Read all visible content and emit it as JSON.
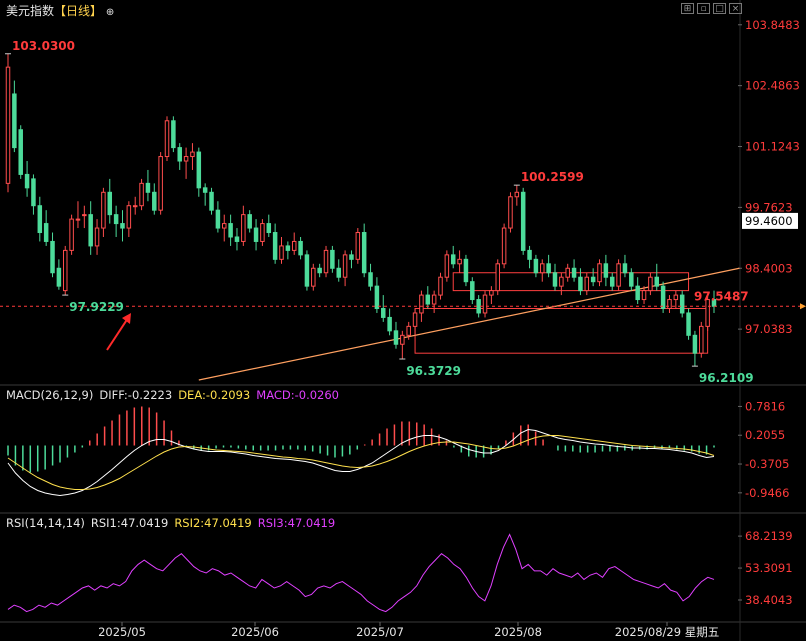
{
  "title": "美元指数",
  "period_tag": "【日线】",
  "header_icon": "plus-circle-icon",
  "window_buttons": [
    "grid-icon",
    "restore-icon",
    "max-icon",
    "close-icon"
  ],
  "colors": {
    "background": "#000000",
    "up": "#ff4d4d",
    "down": "#4ddb9a",
    "price_label": "#ff3b3b",
    "axis_text": "#ff3b3b",
    "trendline": "#ffa060",
    "box": "#ff4040",
    "current_price_box": "#ffffff",
    "macd_diff": "#ffffff",
    "macd_dea": "#ffe04d",
    "rsi1": "#e040ff",
    "rsi2": "#ffe04d",
    "rsi3": "#e040ff",
    "date_axis_text": "#e6e6e6"
  },
  "main": {
    "y_ticks": [
      "103.8483",
      "102.4863",
      "101.1243",
      "99.7623",
      "98.4003",
      "97.0383"
    ],
    "current_price": "99.4600",
    "last_close_label": "97.5487",
    "annotations": {
      "high": {
        "text": "103.0300",
        "color": "#ff3b3b"
      },
      "low1": {
        "text": "97.9229",
        "color": "#4ddb9a"
      },
      "peak2": {
        "text": "100.2599",
        "color": "#ff3b3b"
      },
      "low2": {
        "text": "96.3729",
        "color": "#4ddb9a"
      },
      "low3": {
        "text": "96.2109",
        "color": "#4ddb9a"
      }
    }
  },
  "macd": {
    "label": "MACD(26,12,9)",
    "diff": "DIFF:-0.2223",
    "dea": "DEA:-0.2093",
    "macd": "MACD:-0.0260",
    "y_ticks": [
      "0.7816",
      "0.2055",
      "-0.3705",
      "-0.9466"
    ]
  },
  "rsi": {
    "label": "RSI(14,14,14)",
    "rsi1": "RSI1:47.0419",
    "rsi2": "RSI2:47.0419",
    "rsi3": "RSI3:47.0419",
    "y_ticks": [
      "68.2139",
      "53.3091",
      "38.4043"
    ]
  },
  "x_axis": {
    "labels": [
      "2025/05",
      "2025/06",
      "2025/07",
      "2025/08",
      "2025/08/29 星期五"
    ]
  },
  "chart_data": [
    {
      "type": "candlestick",
      "y_range": [
        95.9,
        104.0
      ],
      "ohlc": [
        [
          100.3,
          103.2,
          100.1,
          102.9
        ],
        [
          102.3,
          102.6,
          101.0,
          101.1
        ],
        [
          101.5,
          101.6,
          100.4,
          100.5
        ],
        [
          100.5,
          100.8,
          100.0,
          100.2
        ],
        [
          100.4,
          100.5,
          99.6,
          99.8
        ],
        [
          99.8,
          100.0,
          99.0,
          99.2
        ],
        [
          99.4,
          99.7,
          98.9,
          99.0
        ],
        [
          99.0,
          99.2,
          98.2,
          98.3
        ],
        [
          98.4,
          98.6,
          97.92,
          98.0
        ],
        [
          97.9,
          98.9,
          97.8,
          98.8
        ],
        [
          98.8,
          99.6,
          98.7,
          99.5
        ],
        [
          99.5,
          99.9,
          99.3,
          99.5
        ],
        [
          99.6,
          99.8,
          99.3,
          99.6
        ],
        [
          99.6,
          99.9,
          98.7,
          98.9
        ],
        [
          98.9,
          99.5,
          98.7,
          99.3
        ],
        [
          99.3,
          100.2,
          99.1,
          100.1
        ],
        [
          100.1,
          100.4,
          99.4,
          99.6
        ],
        [
          99.6,
          99.8,
          99.1,
          99.4
        ],
        [
          99.4,
          99.7,
          99.0,
          99.3
        ],
        [
          99.3,
          99.9,
          99.1,
          99.8
        ],
        [
          99.8,
          100.0,
          99.6,
          99.8
        ],
        [
          99.8,
          100.4,
          99.7,
          100.3
        ],
        [
          100.3,
          100.6,
          99.9,
          100.1
        ],
        [
          100.1,
          100.3,
          99.6,
          99.7
        ],
        [
          99.7,
          101.0,
          99.6,
          100.9
        ],
        [
          100.9,
          101.8,
          100.8,
          101.7
        ],
        [
          101.7,
          101.8,
          101.0,
          101.1
        ],
        [
          101.1,
          101.2,
          100.6,
          100.8
        ],
        [
          100.8,
          101.1,
          100.4,
          100.9
        ],
        [
          100.9,
          101.2,
          100.6,
          101.0
        ],
        [
          101.0,
          101.1,
          100.0,
          100.2
        ],
        [
          100.2,
          100.3,
          99.8,
          100.1
        ],
        [
          100.1,
          100.2,
          99.6,
          99.7
        ],
        [
          99.7,
          99.9,
          99.2,
          99.3
        ],
        [
          99.3,
          99.6,
          99.0,
          99.4
        ],
        [
          99.4,
          99.6,
          98.9,
          99.1
        ],
        [
          99.1,
          99.3,
          98.8,
          99.0
        ],
        [
          99.0,
          99.8,
          98.9,
          99.6
        ],
        [
          99.6,
          99.7,
          99.2,
          99.3
        ],
        [
          99.3,
          99.5,
          98.8,
          99.0
        ],
        [
          99.0,
          99.5,
          98.9,
          99.4
        ],
        [
          99.4,
          99.6,
          99.1,
          99.2
        ],
        [
          99.2,
          99.4,
          98.5,
          98.6
        ],
        [
          98.6,
          99.1,
          98.5,
          98.9
        ],
        [
          98.9,
          99.0,
          98.6,
          98.8
        ],
        [
          98.8,
          99.2,
          98.7,
          99.0
        ],
        [
          99.0,
          99.1,
          98.6,
          98.7
        ],
        [
          98.7,
          98.8,
          97.9,
          98.0
        ],
        [
          98.0,
          98.5,
          97.9,
          98.4
        ],
        [
          98.4,
          98.5,
          98.2,
          98.3
        ],
        [
          98.3,
          98.9,
          98.2,
          98.8
        ],
        [
          98.8,
          98.9,
          98.3,
          98.4
        ],
        [
          98.4,
          98.6,
          98.1,
          98.2
        ],
        [
          98.2,
          98.8,
          98.0,
          98.7
        ],
        [
          98.7,
          98.8,
          98.4,
          98.6
        ],
        [
          98.6,
          99.3,
          98.5,
          99.2
        ],
        [
          99.2,
          99.4,
          98.2,
          98.3
        ],
        [
          98.3,
          98.5,
          97.9,
          98.0
        ],
        [
          98.0,
          98.2,
          97.4,
          97.5
        ],
        [
          97.5,
          97.8,
          97.2,
          97.3
        ],
        [
          97.3,
          97.5,
          96.9,
          97.0
        ],
        [
          97.0,
          97.2,
          96.6,
          96.7
        ],
        [
          96.7,
          97.0,
          96.37,
          96.9
        ],
        [
          96.9,
          97.2,
          96.8,
          97.1
        ],
        [
          97.1,
          97.5,
          96.9,
          97.4
        ],
        [
          97.4,
          97.9,
          97.2,
          97.8
        ],
        [
          97.8,
          98.0,
          97.5,
          97.6
        ],
        [
          97.6,
          97.9,
          97.4,
          97.8
        ],
        [
          97.8,
          98.3,
          97.7,
          98.2
        ],
        [
          98.2,
          98.8,
          98.1,
          98.7
        ],
        [
          98.7,
          98.9,
          98.4,
          98.5
        ],
        [
          98.5,
          98.8,
          98.3,
          98.6
        ],
        [
          98.6,
          98.7,
          98.0,
          98.1
        ],
        [
          98.1,
          98.2,
          97.6,
          97.7
        ],
        [
          97.7,
          97.8,
          97.3,
          97.4
        ],
        [
          97.4,
          97.9,
          97.3,
          97.8
        ],
        [
          97.8,
          98.0,
          97.6,
          97.9
        ],
        [
          97.9,
          98.6,
          97.8,
          98.5
        ],
        [
          98.5,
          99.4,
          98.4,
          99.3
        ],
        [
          99.3,
          100.1,
          99.2,
          100.0
        ],
        [
          100.0,
          100.26,
          99.8,
          100.1
        ],
        [
          100.1,
          100.2,
          98.7,
          98.8
        ],
        [
          98.8,
          98.9,
          98.4,
          98.6
        ],
        [
          98.6,
          98.7,
          98.2,
          98.3
        ],
        [
          98.3,
          98.6,
          98.1,
          98.5
        ],
        [
          98.5,
          98.7,
          98.2,
          98.3
        ],
        [
          98.3,
          98.5,
          97.9,
          98.0
        ],
        [
          98.0,
          98.3,
          97.8,
          98.2
        ],
        [
          98.2,
          98.5,
          98.1,
          98.4
        ],
        [
          98.4,
          98.6,
          98.1,
          98.2
        ],
        [
          98.2,
          98.4,
          97.8,
          97.9
        ],
        [
          97.9,
          98.3,
          97.8,
          98.2
        ],
        [
          98.2,
          98.4,
          98.0,
          98.1
        ],
        [
          98.1,
          98.6,
          98.0,
          98.5
        ],
        [
          98.5,
          98.7,
          98.0,
          98.2
        ],
        [
          98.2,
          98.3,
          97.9,
          98.0
        ],
        [
          98.0,
          98.6,
          97.9,
          98.5
        ],
        [
          98.5,
          98.7,
          98.2,
          98.3
        ],
        [
          98.3,
          98.4,
          97.9,
          98.0
        ],
        [
          98.0,
          98.2,
          97.6,
          97.7
        ],
        [
          97.7,
          98.0,
          97.6,
          97.9
        ],
        [
          97.9,
          98.3,
          97.8,
          98.2
        ],
        [
          98.2,
          98.5,
          97.9,
          98.0
        ],
        [
          98.0,
          98.1,
          97.4,
          97.5
        ],
        [
          97.5,
          97.8,
          97.4,
          97.7
        ],
        [
          97.7,
          97.9,
          97.5,
          97.8
        ],
        [
          97.8,
          97.9,
          97.3,
          97.4
        ],
        [
          97.4,
          97.5,
          96.8,
          96.9
        ],
        [
          96.9,
          97.0,
          96.21,
          96.5
        ],
        [
          96.5,
          97.2,
          96.4,
          97.1
        ],
        [
          97.1,
          97.8,
          97.0,
          97.7
        ],
        [
          97.7,
          97.9,
          97.4,
          97.55
        ]
      ],
      "trendline": {
        "from_index": 30,
        "from_value": 95.9,
        "to_index": 115,
        "to_value": 98.4
      },
      "zones": [
        {
          "start_index": 70,
          "end_index": 107,
          "low": 97.9,
          "high": 98.3
        },
        {
          "start_index": 64,
          "end_index": 110,
          "low": 96.5,
          "high": 97.5
        }
      ]
    },
    {
      "type": "bar+line",
      "name": "MACD",
      "y_range": [
        -1.25,
        0.95
      ],
      "diff": [
        -0.35,
        -0.55,
        -0.7,
        -0.82,
        -0.9,
        -0.95,
        -0.98,
        -1.0,
        -0.98,
        -0.95,
        -0.9,
        -0.82,
        -0.72,
        -0.6,
        -0.48,
        -0.35,
        -0.22,
        -0.1,
        0.0,
        0.08,
        0.12,
        0.12,
        0.08,
        0.02,
        -0.03,
        -0.07,
        -0.1,
        -0.12,
        -0.12,
        -0.12,
        -0.13,
        -0.15,
        -0.17,
        -0.2,
        -0.22,
        -0.24,
        -0.26,
        -0.27,
        -0.28,
        -0.3,
        -0.32,
        -0.35,
        -0.4,
        -0.45,
        -0.5,
        -0.52,
        -0.52,
        -0.48,
        -0.42,
        -0.35,
        -0.25,
        -0.15,
        -0.05,
        0.05,
        0.12,
        0.17,
        0.2,
        0.2,
        0.17,
        0.12,
        0.05,
        -0.02,
        -0.08,
        -0.12,
        -0.15,
        -0.15,
        -0.1,
        0.0,
        0.12,
        0.25,
        0.32,
        0.3,
        0.25,
        0.2,
        0.15,
        0.12,
        0.1,
        0.07,
        0.05,
        0.03,
        0.02,
        0.0,
        -0.02,
        -0.03,
        -0.05,
        -0.05,
        -0.06,
        -0.06,
        -0.07,
        -0.08,
        -0.1,
        -0.12,
        -0.15,
        -0.2,
        -0.24,
        -0.22
      ],
      "dea": [
        -0.25,
        -0.35,
        -0.45,
        -0.55,
        -0.64,
        -0.71,
        -0.78,
        -0.83,
        -0.86,
        -0.88,
        -0.88,
        -0.87,
        -0.84,
        -0.79,
        -0.73,
        -0.66,
        -0.57,
        -0.48,
        -0.39,
        -0.3,
        -0.21,
        -0.13,
        -0.07,
        -0.03,
        -0.02,
        -0.03,
        -0.05,
        -0.07,
        -0.09,
        -0.1,
        -0.11,
        -0.12,
        -0.13,
        -0.15,
        -0.17,
        -0.19,
        -0.21,
        -0.23,
        -0.24,
        -0.26,
        -0.27,
        -0.29,
        -0.32,
        -0.35,
        -0.38,
        -0.41,
        -0.43,
        -0.44,
        -0.43,
        -0.41,
        -0.37,
        -0.32,
        -0.26,
        -0.19,
        -0.12,
        -0.06,
        -0.01,
        0.03,
        0.06,
        0.07,
        0.07,
        0.05,
        0.03,
        0.0,
        -0.03,
        -0.06,
        -0.07,
        -0.05,
        -0.01,
        0.05,
        0.11,
        0.16,
        0.19,
        0.2,
        0.2,
        0.18,
        0.16,
        0.14,
        0.12,
        0.1,
        0.08,
        0.06,
        0.04,
        0.02,
        0.0,
        -0.01,
        -0.02,
        -0.03,
        -0.04,
        -0.05,
        -0.06,
        -0.07,
        -0.09,
        -0.12,
        -0.15,
        -0.2
      ]
    },
    {
      "type": "line",
      "name": "RSI",
      "y_range": [
        30,
        72
      ],
      "series": [
        {
          "values": [
            34,
            36,
            35,
            33,
            34,
            36,
            35,
            37,
            36,
            38,
            40,
            42,
            44,
            45,
            43,
            45,
            44,
            46,
            45,
            47,
            52,
            55,
            57,
            55,
            53,
            52,
            55,
            58,
            60,
            57,
            54,
            52,
            51,
            53,
            52,
            50,
            51,
            49,
            47,
            45,
            44,
            48,
            46,
            44,
            45,
            47,
            45,
            43,
            40,
            41,
            44,
            45,
            44,
            46,
            47,
            45,
            43,
            41,
            38,
            36,
            34,
            33,
            35,
            38,
            40,
            42,
            45,
            50,
            54,
            57,
            60,
            58,
            55,
            53,
            49,
            44,
            40,
            38,
            45,
            55,
            63,
            69,
            62,
            53,
            55,
            52,
            52,
            50,
            53,
            51,
            50,
            49,
            51,
            48,
            50,
            51,
            49,
            53,
            54,
            52,
            50,
            48,
            47,
            46,
            45,
            44,
            46,
            43,
            42,
            38,
            40,
            44,
            47,
            49,
            48
          ]
        }
      ]
    }
  ]
}
